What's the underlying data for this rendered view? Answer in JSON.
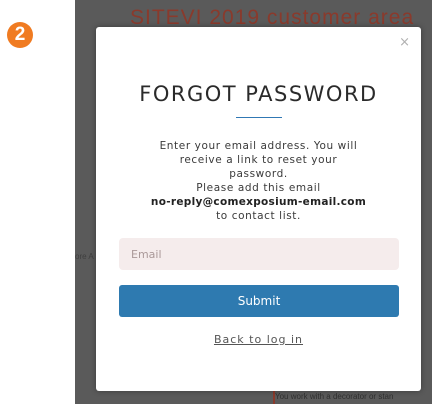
{
  "step": {
    "number": "2",
    "color": "#f07b21"
  },
  "background_page": {
    "title_partial": "SITEVI 2019 customer area",
    "fragments": [
      "ore A",
      "You work with a decorator or stan"
    ],
    "accent_color": "#8a3a2c"
  },
  "modal": {
    "close_symbol": "×",
    "title": "FORGOT PASSWORD",
    "instruction_lines": [
      "Enter your email address. You will",
      "receive a link to reset your",
      "password.",
      "Please add this email"
    ],
    "sender_email": "no-reply@comexposium-email.com",
    "instruction_tail": "to contact list.",
    "email_field": {
      "placeholder": "Email",
      "value": ""
    },
    "submit_label": "Submit",
    "back_link_label": "Back to log in",
    "accent_color": "#2e7ab0"
  }
}
